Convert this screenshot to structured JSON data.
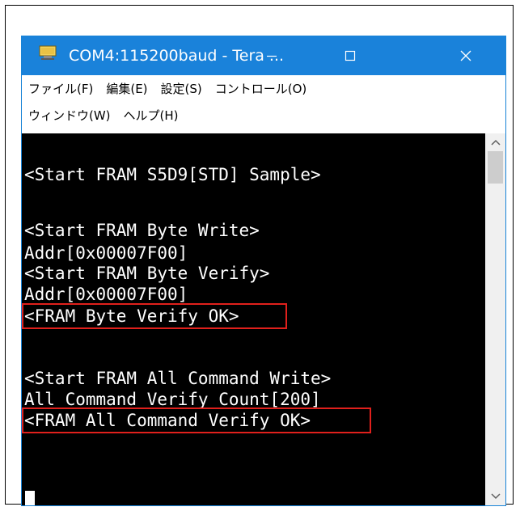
{
  "window": {
    "title": "COM4:115200baud - Tera ...",
    "icon": "teraterm-app-icon",
    "minimize_icon": "minimize-icon",
    "maximize_icon": "maximize-icon",
    "close_icon": "close-icon"
  },
  "menu": {
    "row1": [
      "ファイル(F)",
      "編集(E)",
      "設定(S)",
      "コントロール(O)"
    ],
    "row2": [
      "ウィンドウ(W)",
      "ヘルプ(H)"
    ]
  },
  "terminal": {
    "lines": [
      "<Start FRAM S5D9[STD] Sample>",
      "",
      "<Start FRAM Byte Write>",
      "Addr[0x00007F00]",
      "<Start FRAM Byte Verify>",
      "Addr[0x00007F00]",
      "<FRAM Byte Verify OK>",
      "",
      "<Start FRAM All Command Write>",
      "All Command Verify Count[200]",
      "<FRAM All Command Verify OK>"
    ],
    "highlighted_line_indices": [
      6,
      10
    ]
  },
  "scrollbar": {
    "up_icon": "scroll-up-arrow-icon",
    "down_icon": "scroll-down-arrow-icon"
  },
  "colors": {
    "titlebar": "#1a82da",
    "terminal_bg": "#000000",
    "terminal_text": "#ffffff",
    "highlight": "#e0201c"
  }
}
